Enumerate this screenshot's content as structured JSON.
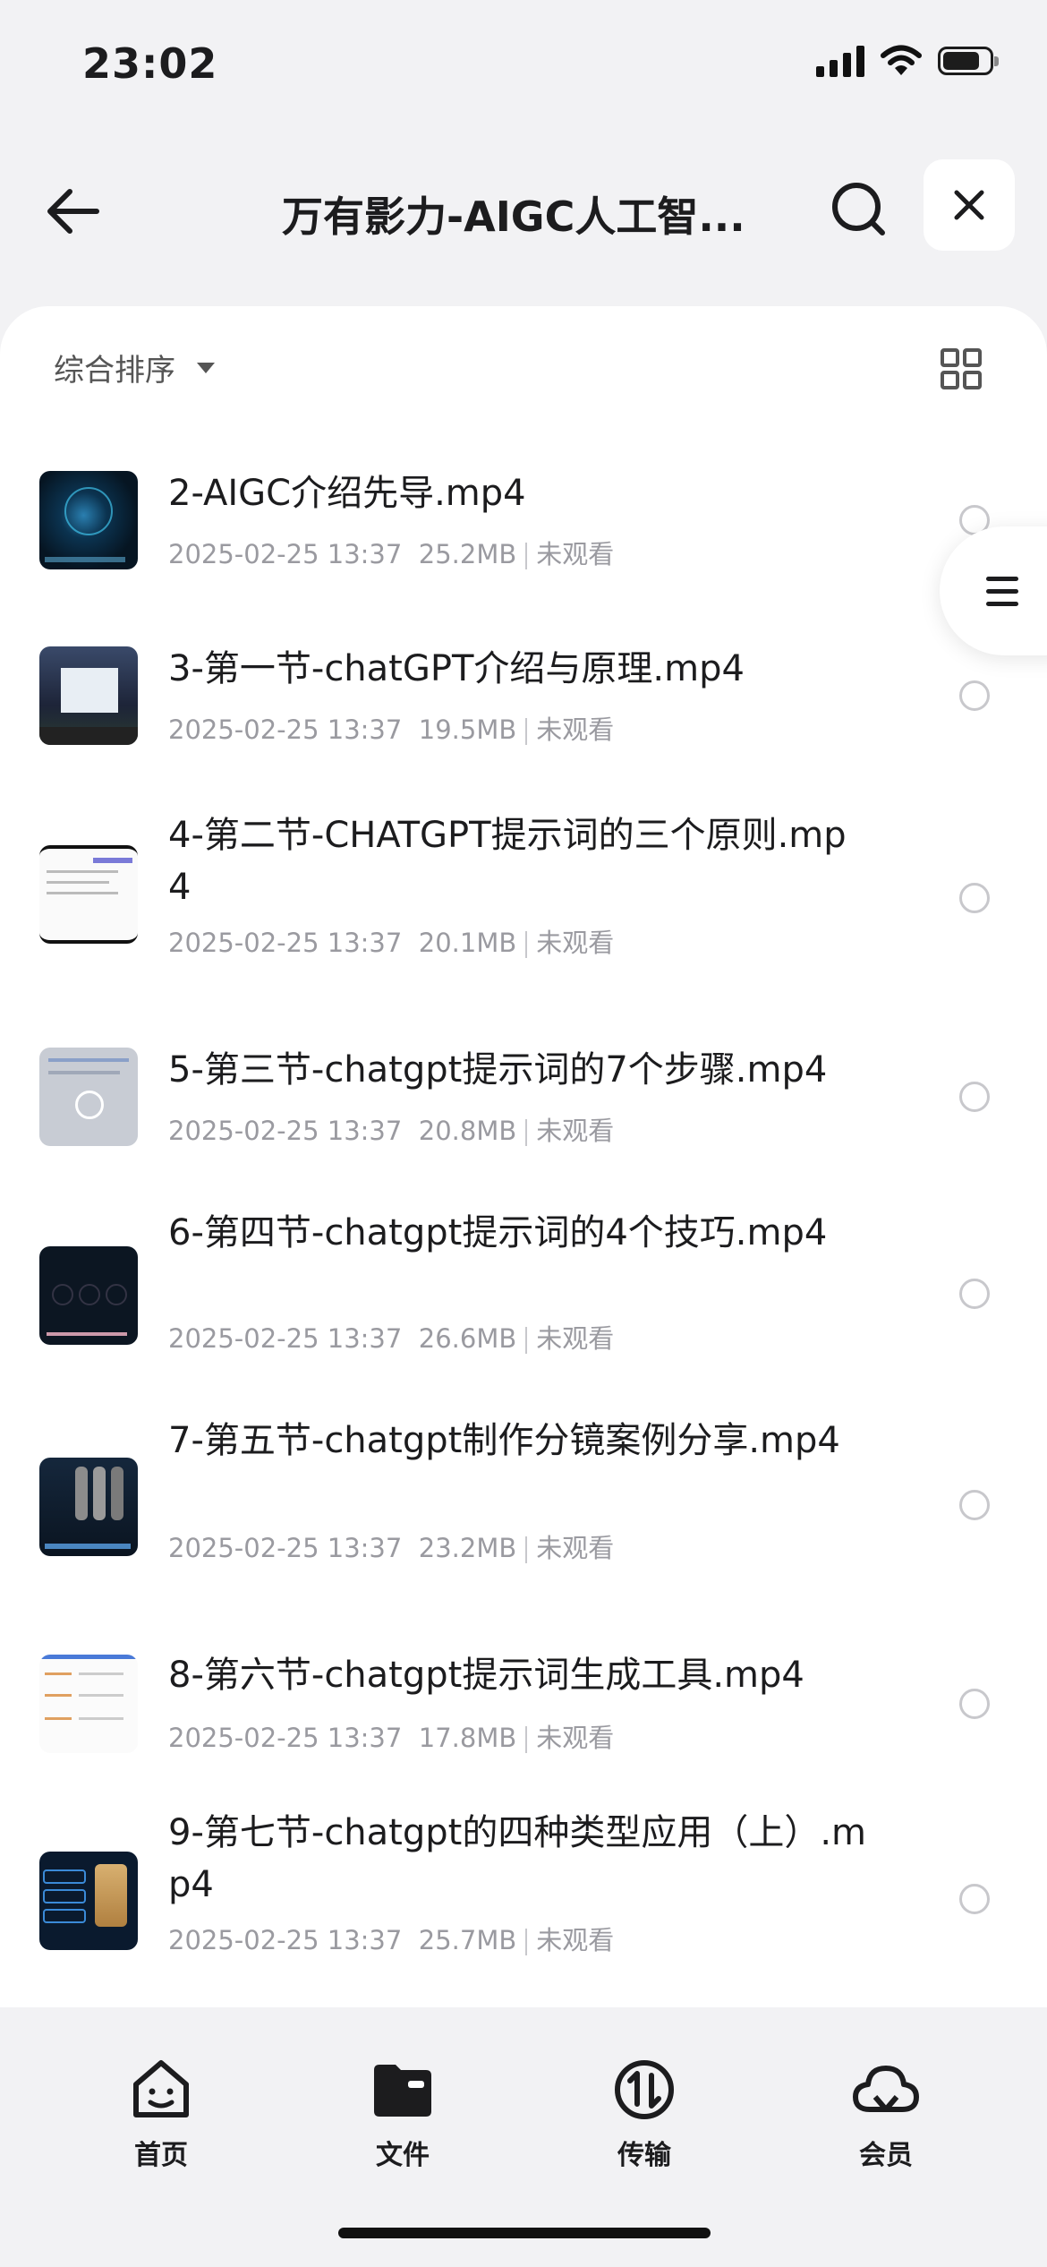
{
  "status_bar": {
    "time": "23:02",
    "battery_level": 0.8
  },
  "header": {
    "title": "万有影力-AIGC人工智...",
    "back_icon": "arrow-left-icon",
    "search_icon": "search-icon",
    "close_icon": "close-icon"
  },
  "toolbar": {
    "sort_label": "综合排序",
    "view_icon": "grid-view-icon"
  },
  "files": [
    {
      "name": "2-AIGC介绍先导.mp4",
      "date": "2025-02-25 13:37",
      "size": "25.2MB",
      "status": "未观看"
    },
    {
      "name": "3-第一节-chatGPT介绍与原理.mp4",
      "date": "2025-02-25 13:37",
      "size": "19.5MB",
      "status": "未观看"
    },
    {
      "name": "4-第二节-CHATGPT提示词的三个原则.mp4",
      "date": "2025-02-25 13:37",
      "size": "20.1MB",
      "status": "未观看"
    },
    {
      "name": "5-第三节-chatgpt提示词的7个步骤.mp4",
      "date": "2025-02-25 13:37",
      "size": "20.8MB",
      "status": "未观看"
    },
    {
      "name": "6-第四节-chatgpt提示词的4个技巧.mp4",
      "date": "2025-02-25 13:37",
      "size": "26.6MB",
      "status": "未观看"
    },
    {
      "name": "7-第五节-chatgpt制作分镜案例分享.mp4",
      "date": "2025-02-25 13:37",
      "size": "23.2MB",
      "status": "未观看"
    },
    {
      "name": "8-第六节-chatgpt提示词生成工具.mp4",
      "date": "2025-02-25 13:37",
      "size": "17.8MB",
      "status": "未观看"
    },
    {
      "name": "9-第七节-chatgpt的四种类型应用（上）.mp4",
      "date": "2025-02-25 13:37",
      "size": "25.7MB",
      "status": "未观看"
    }
  ],
  "bottom_nav": [
    {
      "label": "首页",
      "icon": "home-smile-icon"
    },
    {
      "label": "文件",
      "icon": "folder-icon"
    },
    {
      "label": "传输",
      "icon": "transfer-icon"
    },
    {
      "label": "会员",
      "icon": "cloud-icon"
    }
  ],
  "colors": {
    "background": "#f2f2f4",
    "card": "#ffffff",
    "text": "#1c1c1e",
    "meta": "#9a9aa0"
  }
}
